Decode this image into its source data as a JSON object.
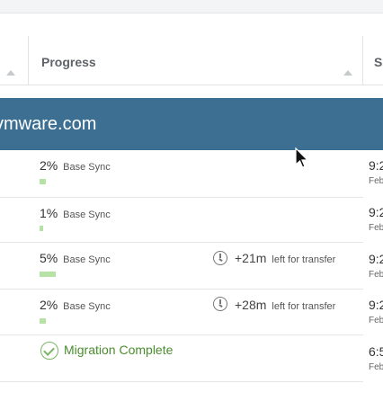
{
  "header": {
    "columns": [
      {
        "label": ""
      },
      {
        "label": "Progress"
      },
      {
        "label": "S"
      }
    ]
  },
  "group": {
    "name": "vmware.com"
  },
  "rows": [
    {
      "progress_pct": "2%",
      "progress_label": "Base Sync",
      "bar_fraction": 0.02,
      "eta": "",
      "eta_label": "",
      "time": "9:2",
      "date": "Feb"
    },
    {
      "progress_pct": "1%",
      "progress_label": "Base Sync",
      "bar_fraction": 0.01,
      "eta": "",
      "eta_label": "",
      "time": "9:2",
      "date": "Feb"
    },
    {
      "progress_pct": "5%",
      "progress_label": "Base Sync",
      "bar_fraction": 0.05,
      "eta": "+21m",
      "eta_label": "left for transfer",
      "time": "9:2",
      "date": "Feb"
    },
    {
      "progress_pct": "2%",
      "progress_label": "Base Sync",
      "bar_fraction": 0.02,
      "eta": "+28m",
      "eta_label": "left for transfer",
      "time": "9:2",
      "date": "Feb"
    },
    {
      "status": "Migration Complete",
      "time": "6:5",
      "date": "Feb"
    }
  ],
  "colors": {
    "banner": "#3d6f93",
    "progress_bar": "#b6e3a5",
    "complete": "#4a8c2f"
  },
  "icons": [
    "clock-icon",
    "check-circle-icon",
    "sort-caret-icon",
    "mouse-cursor-icon"
  ]
}
